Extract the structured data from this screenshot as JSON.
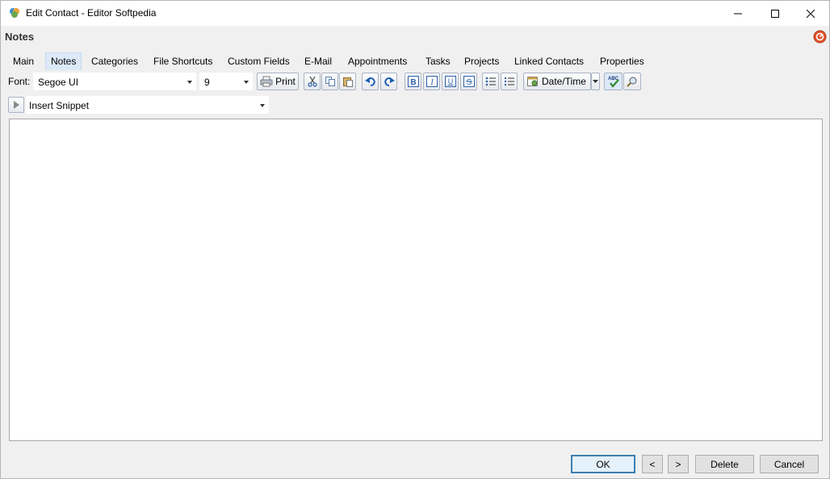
{
  "window": {
    "title": "Edit Contact - Editor Softpedia"
  },
  "section": {
    "title": "Notes"
  },
  "tabs": [
    {
      "label": "Main"
    },
    {
      "label": "Notes"
    },
    {
      "label": "Categories"
    },
    {
      "label": "File Shortcuts"
    },
    {
      "label": "Custom Fields"
    },
    {
      "label": "E-Mail"
    },
    {
      "label": "Appointments"
    },
    {
      "label": "Tasks"
    },
    {
      "label": "Projects"
    },
    {
      "label": "Linked Contacts"
    },
    {
      "label": "Properties"
    }
  ],
  "active_tab": "Notes",
  "toolbar": {
    "font_label": "Font:",
    "font_value": "Segoe UI",
    "size_value": "9",
    "print_label": "Print",
    "datetime_label": "Date/Time",
    "icons": [
      "printer-icon",
      "cut-icon",
      "copy-icon",
      "paste-icon",
      "undo-icon",
      "redo-icon",
      "bold-icon",
      "italic-icon",
      "underline-icon",
      "strikethrough-icon",
      "bullet-list-icon",
      "numbered-list-icon",
      "calendar-icon",
      "spellcheck-icon",
      "find-icon"
    ]
  },
  "snippet": {
    "value": "Insert Snippet"
  },
  "editor": {
    "content": ""
  },
  "footer": {
    "ok": "OK",
    "prev": "<",
    "next": ">",
    "delete": "Delete",
    "cancel": "Cancel"
  }
}
